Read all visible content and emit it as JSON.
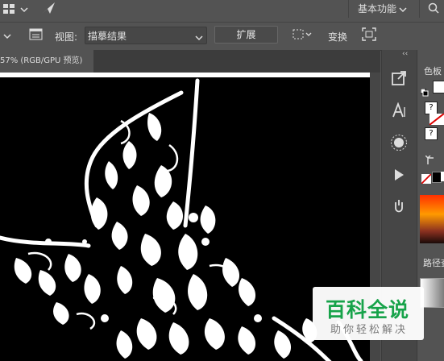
{
  "topbar": {
    "workspace_label": "基本功能",
    "workspace_chevron": "⌄",
    "search_glyph": "⌕"
  },
  "control_bar": {
    "view_label": "视图:",
    "view_value": "描摹结果",
    "expand_label": "扩展",
    "transform_label": "变换"
  },
  "document_tab": {
    "title": "57% (RGB/GPU 预览)"
  },
  "right_panel": {
    "color_label": "色板",
    "path_label": "路径查"
  },
  "watermark": {
    "main": "百科全说",
    "sub": "助你轻松解决"
  },
  "colors": {
    "ui_bg": "#535353",
    "artboard": "#000000",
    "art": "#ffffff",
    "watermark_green": "#17a34a"
  }
}
